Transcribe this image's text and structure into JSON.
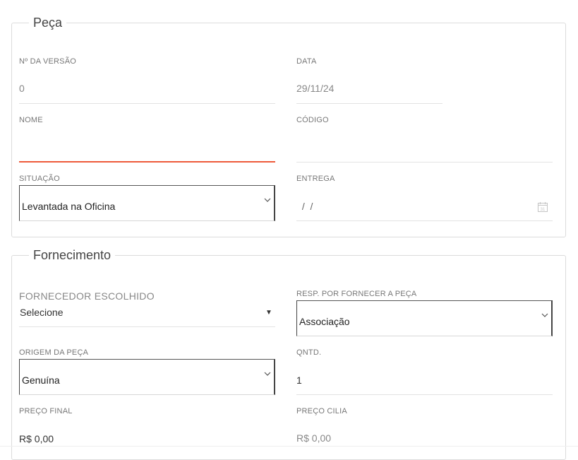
{
  "peca": {
    "legend": "Peça",
    "versao": {
      "label": "Nº DA VERSÃO",
      "value": "0"
    },
    "data": {
      "label": "DATA",
      "value": "29/11/24"
    },
    "nome": {
      "label": "NOME",
      "value": ""
    },
    "codigo": {
      "label": "CÓDIGO",
      "value": ""
    },
    "situacao": {
      "label": "SITUAÇÃO",
      "value": "Levantada na Oficina"
    },
    "entrega": {
      "label": "ENTREGA",
      "value": " /  /"
    }
  },
  "fornecimento": {
    "legend": "Fornecimento",
    "fornecedor": {
      "label": "FORNECEDOR ESCOLHIDO",
      "value": "Selecione"
    },
    "responsavel": {
      "label": "RESP. POR FORNECER A PEÇA",
      "value": "Associação"
    },
    "origem": {
      "label": "ORIGEM DA PEÇA",
      "value": "Genuína"
    },
    "qntd": {
      "label": "QNTD.",
      "value": "1"
    },
    "preco_final": {
      "label": "PREÇO FINAL",
      "value": "R$ 0,00"
    },
    "preco_cilia": {
      "label": "PREÇO CILIA",
      "value": "R$ 0,00"
    }
  },
  "colors": {
    "accent": "#ee5a3a",
    "border": "#dcdcdc",
    "label": "#777777"
  },
  "icons": {
    "select_arrow": "chevron-down-icon",
    "calendar": "calendar-icon",
    "dropdown_caret": "caret-down-icon"
  }
}
